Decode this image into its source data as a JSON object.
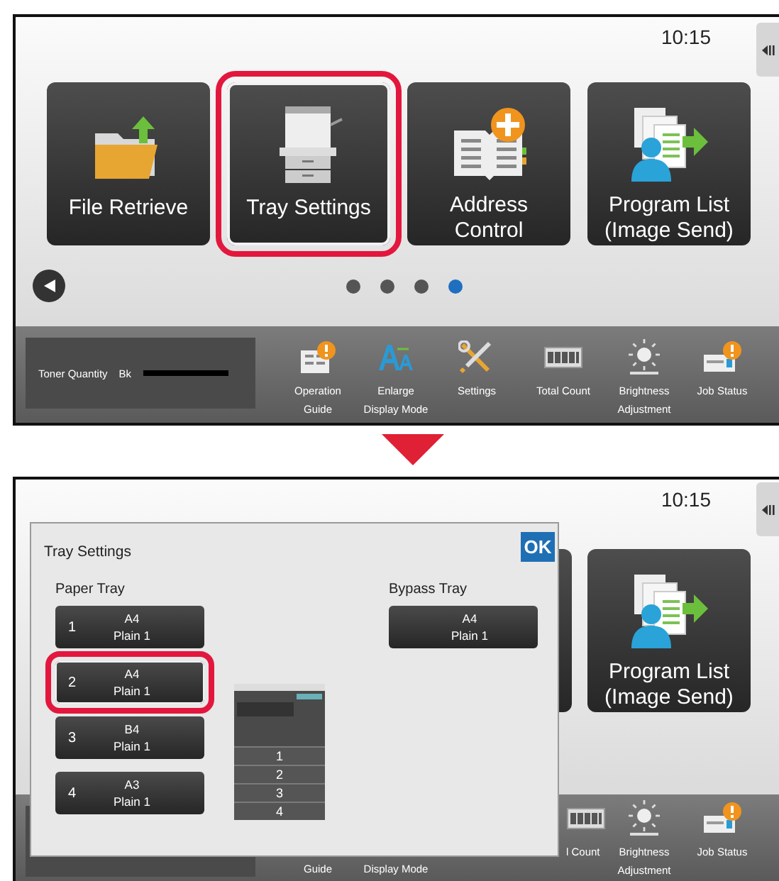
{
  "home_screen": {
    "clock": "10:15",
    "tiles": [
      {
        "kind": "folder",
        "label": "File Retrieve",
        "selected": false
      },
      {
        "kind": "printer",
        "label": "Tray Settings",
        "selected": true
      },
      {
        "kind": "address-book",
        "label": "Address Control",
        "selected": false
      },
      {
        "kind": "program-list",
        "label": "Program List (Image Send)",
        "selected": false
      }
    ],
    "page_dots": [
      {
        "selected": false
      },
      {
        "selected": false
      },
      {
        "selected": false
      },
      {
        "selected": true
      }
    ],
    "toner": {
      "label": "Toner Quantity",
      "color_label": "Bk",
      "level": 1
    },
    "bar_items": [
      {
        "kind": "guide",
        "lines": [
          "Operation",
          "Guide"
        ]
      },
      {
        "kind": "enlarge",
        "lines": [
          "Enlarge",
          "Display Mode"
        ]
      },
      {
        "kind": "settings",
        "lines": [
          "Settings"
        ]
      },
      {
        "kind": "counter",
        "lines": [
          "Total Count"
        ]
      },
      {
        "kind": "brightness",
        "lines": [
          "Brightness",
          "Adjustment"
        ]
      },
      {
        "kind": "job-status",
        "lines": [
          "Job Status"
        ]
      }
    ]
  },
  "tray_settings_screen": {
    "clock": "10:15",
    "tiles": [
      {
        "kind": "program-list",
        "label": "Program List (Image Send)",
        "selected": false
      }
    ],
    "bar_items": [
      {
        "kind": "label-only",
        "lines": [
          "Guide"
        ]
      },
      {
        "kind": "label-only",
        "lines": [
          "Display Mode"
        ]
      },
      {
        "kind": "covered"
      },
      {
        "kind": "counter",
        "lines": [
          "l Count"
        ]
      },
      {
        "kind": "brightness",
        "lines": [
          "Brightness",
          "Adjustment"
        ]
      },
      {
        "kind": "job-status",
        "lines": [
          "Job Status"
        ]
      }
    ],
    "dialog": {
      "title": "Tray Settings",
      "ok": "OK",
      "paper_tray_label": "Paper Tray",
      "bypass_tray_label": "Bypass Tray",
      "trays": [
        {
          "number": "1",
          "size": "A4",
          "type": "Plain 1",
          "selected": false
        },
        {
          "number": "2",
          "size": "A4",
          "type": "Plain 1",
          "selected": true
        },
        {
          "number": "3",
          "size": "B4",
          "type": "Plain 1",
          "selected": false
        },
        {
          "number": "4",
          "size": "A3",
          "type": "Plain 1",
          "selected": false
        }
      ],
      "drawer_labels": [
        "1",
        "2",
        "3",
        "4"
      ],
      "bypass": {
        "size": "A4",
        "type": "Plain 1"
      }
    }
  }
}
